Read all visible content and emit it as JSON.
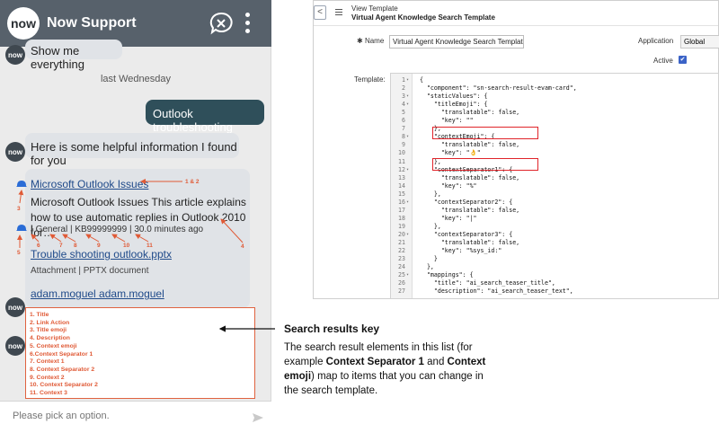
{
  "chat": {
    "avatar_text": "now",
    "title": "Now Support",
    "messages": {
      "show_me": "Show me everything",
      "day_separator": "last Wednesday",
      "user_query": "Outlook troubleshooting",
      "bot_intro": "Here is some helpful information I found for you"
    },
    "result": {
      "title_link": "Microsoft Outlook Issues",
      "description": "Microsoft Outlook Issues This article explains how to use automatic replies in Outlook 2010 for…",
      "context": [
        "General",
        "KB99999999",
        "30.0 minutes ago"
      ],
      "context_separator": "|",
      "attachment_link": "Trouble shooting outlook.pptx",
      "attachment_meta": "Attachment | PPTX document",
      "author_link": "adam.moguel adam.moguel"
    },
    "input_placeholder": "Please pick an option."
  },
  "annotations": {
    "n12": "1 & 2",
    "n3": "3",
    "n4": "4",
    "n5": "5",
    "n6": "6",
    "n7": "7",
    "n8": "8",
    "n9": "9",
    "n10": "10",
    "n11": "11"
  },
  "key_list": [
    "1. Title",
    "2. Link Action",
    "3. Title emoji",
    "4. Description",
    "5. Context emoji",
    "6.Context Separator 1",
    "7. Context 1",
    "8. Context Separator 2",
    "9. Context 2",
    "10. Context Separator 2",
    "11. Context 3"
  ],
  "editor": {
    "back_label": "<",
    "kind_label": "View Template",
    "title": "Virtual Agent Knowledge Search Template",
    "name_label": "Name",
    "name_value": "Virtual Agent Knowledge Search Template",
    "application_label": "Application",
    "application_value": "Global",
    "active_label": "Active",
    "active_mark": "✔",
    "template_label": "Template:",
    "required_mark": "✱"
  },
  "code_lines": [
    {
      "n": "1",
      "fold": "▾",
      "text": "{"
    },
    {
      "n": "2",
      "fold": "",
      "text": "  \"component\": \"sn-search-result-evam-card\","
    },
    {
      "n": "3",
      "fold": "▾",
      "text": "  \"staticValues\": {"
    },
    {
      "n": "4",
      "fold": "▾",
      "text": "    \"titleEmoji\": {"
    },
    {
      "n": "5",
      "fold": "",
      "text": "      \"translatable\": false,"
    },
    {
      "n": "6",
      "fold": "",
      "text": "      \"key\": \"\""
    },
    {
      "n": "7",
      "fold": "",
      "text": "    },"
    },
    {
      "n": "8",
      "fold": "▾",
      "text": "    \"contextEmoji\": {"
    },
    {
      "n": "9",
      "fold": "",
      "text": "      \"translatable\": false,"
    },
    {
      "n": "10",
      "fold": "",
      "text": "      \"key\": \"👌\""
    },
    {
      "n": "11",
      "fold": "",
      "text": "    },"
    },
    {
      "n": "12",
      "fold": "▾",
      "text": "    \"contextSeparator1\": {"
    },
    {
      "n": "13",
      "fold": "",
      "text": "      \"translatable\": false,"
    },
    {
      "n": "14",
      "fold": "",
      "text": "      \"key\": \"%\""
    },
    {
      "n": "15",
      "fold": "",
      "text": "    },"
    },
    {
      "n": "16",
      "fold": "▾",
      "text": "    \"contextSeparator2\": {"
    },
    {
      "n": "17",
      "fold": "",
      "text": "      \"translatable\": false,"
    },
    {
      "n": "18",
      "fold": "",
      "text": "      \"key\": \"|\""
    },
    {
      "n": "19",
      "fold": "",
      "text": "    },"
    },
    {
      "n": "20",
      "fold": "▾",
      "text": "    \"contextSeparator3\": {"
    },
    {
      "n": "21",
      "fold": "",
      "text": "      \"translatable\": false,"
    },
    {
      "n": "22",
      "fold": "",
      "text": "      \"key\": \"%sys_id:\""
    },
    {
      "n": "23",
      "fold": "",
      "text": "    }"
    },
    {
      "n": "24",
      "fold": "",
      "text": "  },"
    },
    {
      "n": "25",
      "fold": "▾",
      "text": "  \"mappings\": {"
    },
    {
      "n": "26",
      "fold": "",
      "text": "    \"title\": \"ai_search_teaser_title\","
    },
    {
      "n": "27",
      "fold": "",
      "text": "    \"description\": \"ai_search_teaser_text\","
    }
  ],
  "key_panel": {
    "title": "Search results key",
    "desc_1": "The search result elements in this list (for example ",
    "bold_1": "Context Separator 1",
    "desc_2": " and ",
    "bold_2": "Context emoji",
    "desc_3": ") map to items that you can change in the search template."
  },
  "colors": {
    "header": "#57616b",
    "user_bubble": "#2f4f5a",
    "annotation": "#e05a36",
    "highlight": "#e0242a",
    "link": "#1f4a8a"
  }
}
